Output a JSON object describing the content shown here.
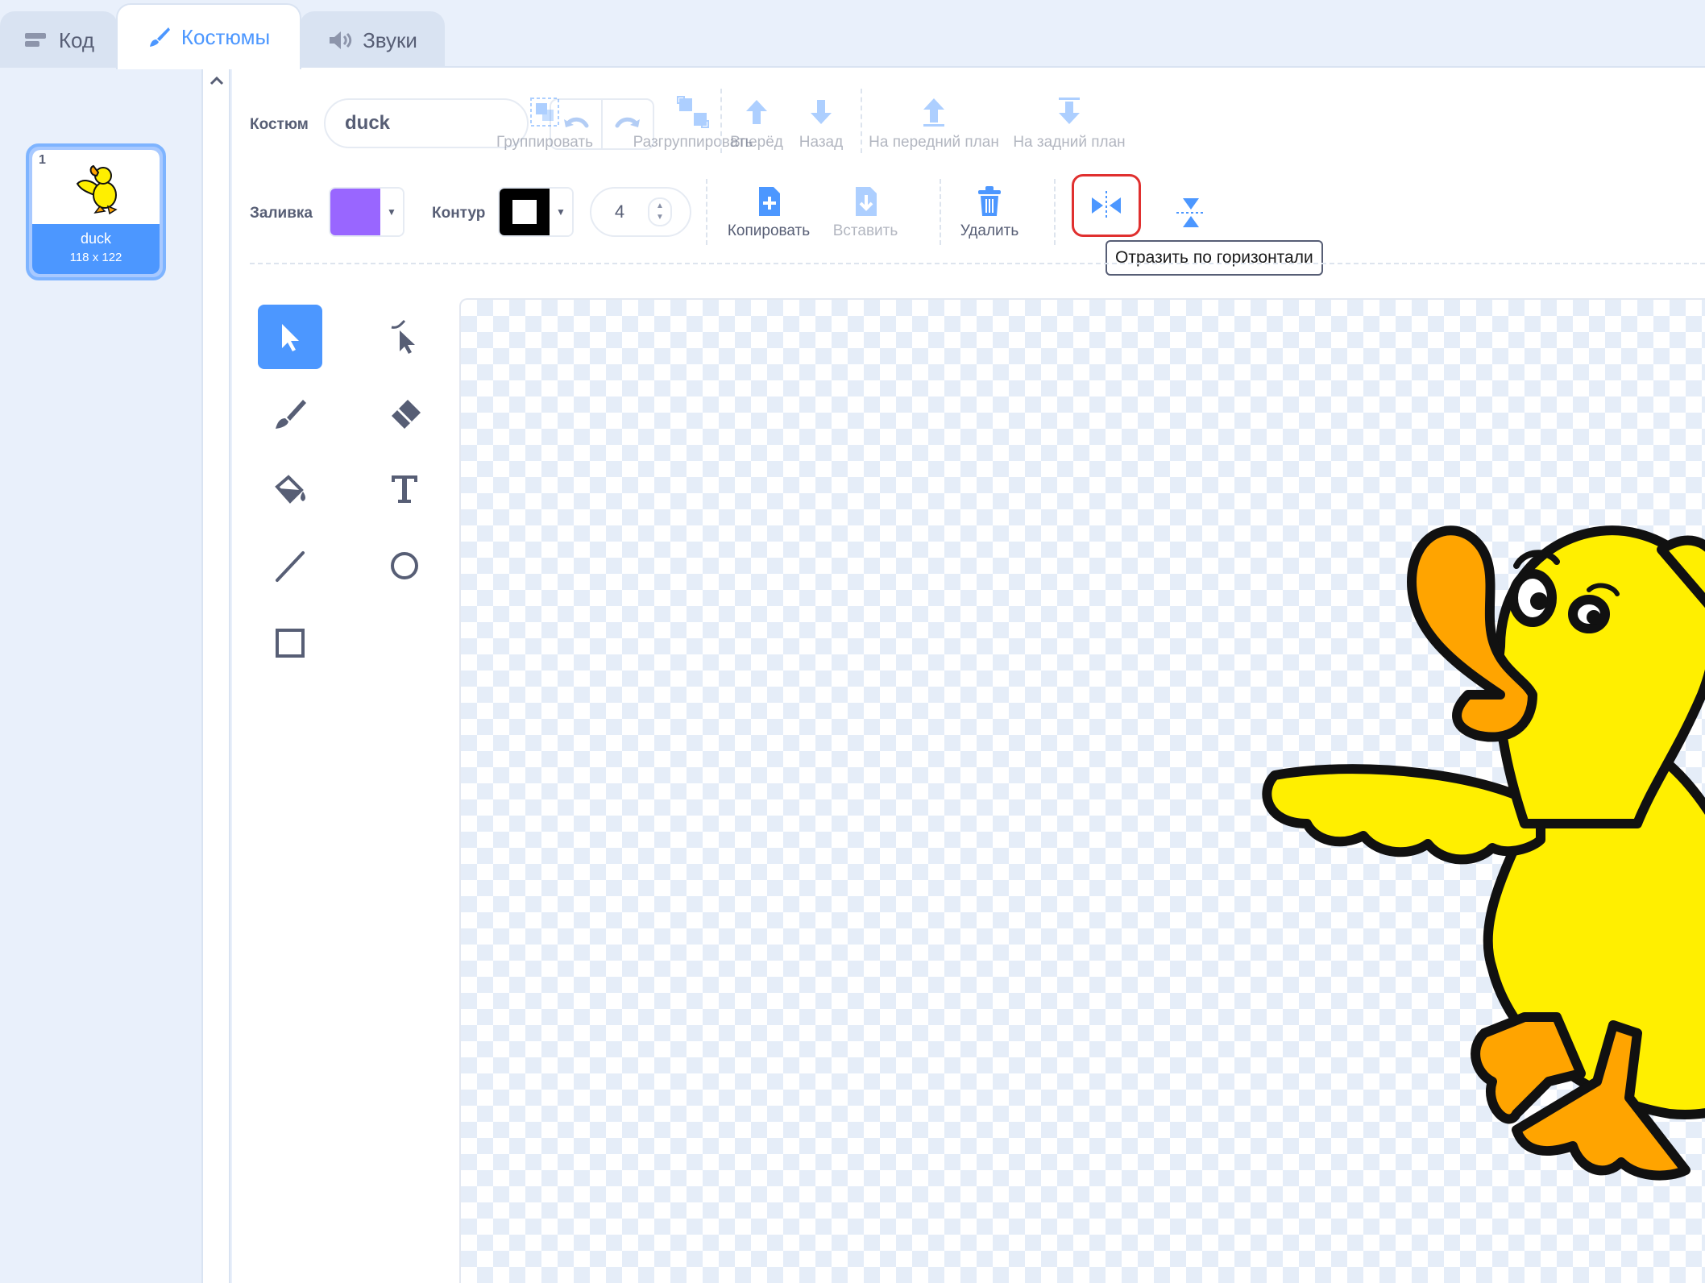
{
  "tabs": [
    {
      "label": "Код",
      "icon": "code-icon"
    },
    {
      "label": "Костюмы",
      "icon": "brush-icon"
    },
    {
      "label": "Звуки",
      "icon": "speaker-icon"
    }
  ],
  "active_tab": "Костюмы",
  "costumes": [
    {
      "number": "1",
      "name": "duck",
      "size": "118 x 122"
    }
  ],
  "editor": {
    "costume_label": "Костюм",
    "costume_name": "duck",
    "fill_label": "Заливка",
    "fill_color": "#9966ff",
    "outline_label": "Контур",
    "outline_color": "#000000",
    "outline_width": "4",
    "buttons": {
      "group": "Группировать",
      "ungroup": "Разгруппировать",
      "forward": "Вперёд",
      "backward": "Назад",
      "front": "На передний план",
      "back": "На задний план",
      "copy": "Копировать",
      "paste": "Вставить",
      "delete": "Удалить"
    },
    "tooltip": "Отразить по горизонтали"
  },
  "colors": {
    "accent": "#4c97ff",
    "highlight_border": "#e0302f",
    "duck_body": "#ffef00",
    "duck_beak": "#ffa400"
  }
}
